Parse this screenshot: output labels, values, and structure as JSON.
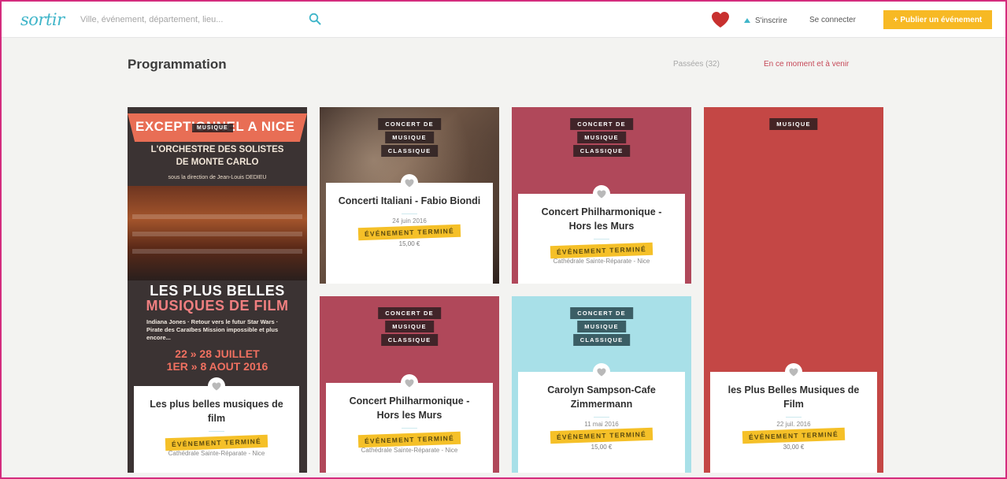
{
  "header": {
    "logo": "sortir",
    "search_placeholder": "Ville, événement, département, lieu...",
    "signup": "S'inscrire",
    "login": "Se connecter",
    "publish": "+ Publier un événement"
  },
  "section": {
    "title": "Programmation",
    "tab_past": "Passées (32)",
    "tab_upcoming": "En ce moment et à venir"
  },
  "colors": {
    "accent_pink": "#c64a59",
    "publish_yellow": "#f7b924",
    "card_rose": "#b0485a",
    "card_red": "#c44745",
    "card_blue": "#a8e0e8",
    "stamp_yellow": "#f5c028"
  },
  "cards": [
    {
      "badge": [
        "MUSIQUE"
      ],
      "title": "Les plus belles musiques de film",
      "stamp": "ÉVÉNEMENT TERMINÉ",
      "venue": "Cathédrale Sainte-Réparate - Nice",
      "poster": {
        "banner": "EXCEPTIONNEL A NICE",
        "orchestra": "L'ORCHESTRE DES SOLISTES DE MONTE CARLO",
        "director": "sous la direction de Jean-Louis DEDIEU",
        "headline_1": "LES PLUS BELLES",
        "headline_2": "MUSIQUES DE FILM",
        "films": "Indiana Jones · Retour vers le futur Star Wars · Pirate des Caraïbes Mission impossible et plus encore...",
        "dates_1": "22 » 28 JUILLET",
        "dates_2": "1ER » 8 AOUT 2016"
      }
    },
    {
      "badge": [
        "CONCERT DE",
        "MUSIQUE",
        "CLASSIQUE"
      ],
      "title": "Concerti Italiani - Fabio Biondi",
      "date": "24 juin 2016",
      "stamp": "ÉVÉNEMENT TERMINÉ",
      "price": "15,00 €"
    },
    {
      "badge": [
        "CONCERT DE",
        "MUSIQUE",
        "CLASSIQUE"
      ],
      "title": "Concert Philharmonique - Hors les Murs",
      "stamp": "ÉVÉNEMENT TERMINÉ",
      "venue": "Cathédrale Sainte-Réparate - Nice"
    },
    {
      "badge": [
        "MUSIQUE"
      ],
      "title": "les Plus Belles Musiques de Film",
      "date": "22 juil. 2016",
      "stamp": "ÉVÉNEMENT TERMINÉ",
      "price": "30,00 €"
    },
    {
      "badge": [
        "CONCERT DE",
        "MUSIQUE",
        "CLASSIQUE"
      ],
      "title": "Concert Philharmonique - Hors les Murs",
      "stamp": "ÉVÉNEMENT TERMINÉ",
      "venue": "Cathédrale Sainte-Réparate - Nice"
    },
    {
      "badge": [
        "CONCERT DE",
        "MUSIQUE",
        "CLASSIQUE"
      ],
      "title": "Carolyn Sampson-Cafe Zimmermann",
      "date": "11 mai 2016",
      "stamp": "ÉVÉNEMENT TERMINÉ",
      "price": "15,00 €"
    }
  ]
}
